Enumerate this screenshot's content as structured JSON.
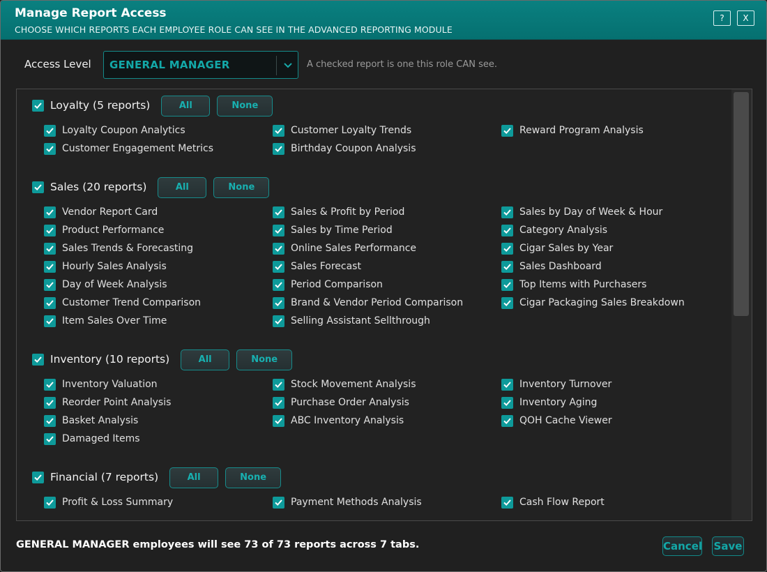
{
  "window": {
    "title": "Manage Report Access",
    "subtitle": "CHOOSE WHICH REPORTS EACH EMPLOYEE ROLE CAN SEE IN THE ADVANCED REPORTING MODULE",
    "help_label": "?",
    "close_label": "X"
  },
  "access": {
    "label": "Access Level",
    "selected": "GENERAL MANAGER",
    "hint": "A checked report is one this role CAN see."
  },
  "groups": [
    {
      "name": "Loyalty",
      "count": "(5 reports)",
      "checked": true,
      "all_label": "All",
      "none_label": "None",
      "items": [
        {
          "label": "Loyalty Coupon Analytics",
          "checked": true
        },
        {
          "label": "Customer Loyalty Trends",
          "checked": true
        },
        {
          "label": "Reward Program Analysis",
          "checked": true
        },
        {
          "label": "Customer Engagement Metrics",
          "checked": true
        },
        {
          "label": "Birthday Coupon Analysis",
          "checked": true
        }
      ]
    },
    {
      "name": "Sales",
      "count": "(20 reports)",
      "checked": true,
      "all_label": "All",
      "none_label": "None",
      "items": [
        {
          "label": "Vendor Report Card",
          "checked": true
        },
        {
          "label": "Sales & Profit by Period",
          "checked": true
        },
        {
          "label": "Sales by Day of Week & Hour",
          "checked": true
        },
        {
          "label": "Product Performance",
          "checked": true
        },
        {
          "label": "Sales by Time Period",
          "checked": true
        },
        {
          "label": "Category Analysis",
          "checked": true
        },
        {
          "label": "Sales Trends & Forecasting",
          "checked": true
        },
        {
          "label": "Online Sales Performance",
          "checked": true
        },
        {
          "label": "Cigar Sales by Year",
          "checked": true
        },
        {
          "label": "Hourly Sales Analysis",
          "checked": true
        },
        {
          "label": "Sales Forecast",
          "checked": true
        },
        {
          "label": "Sales Dashboard",
          "checked": true
        },
        {
          "label": "Day of Week Analysis",
          "checked": true
        },
        {
          "label": "Period Comparison",
          "checked": true
        },
        {
          "label": "Top Items with Purchasers",
          "checked": true
        },
        {
          "label": "Customer Trend Comparison",
          "checked": true
        },
        {
          "label": "Brand & Vendor Period Comparison",
          "checked": true
        },
        {
          "label": "Cigar Packaging Sales Breakdown",
          "checked": true
        },
        {
          "label": "Item Sales Over Time",
          "checked": true
        },
        {
          "label": "Selling Assistant Sellthrough",
          "checked": true
        }
      ]
    },
    {
      "name": "Inventory",
      "count": "(10 reports)",
      "checked": true,
      "all_label": "All",
      "none_label": "None",
      "items": [
        {
          "label": "Inventory Valuation",
          "checked": true
        },
        {
          "label": "Stock Movement Analysis",
          "checked": true
        },
        {
          "label": "Inventory Turnover",
          "checked": true
        },
        {
          "label": "Reorder Point Analysis",
          "checked": true
        },
        {
          "label": "Purchase Order Analysis",
          "checked": true
        },
        {
          "label": "Inventory Aging",
          "checked": true
        },
        {
          "label": "Basket Analysis",
          "checked": true
        },
        {
          "label": "ABC Inventory Analysis",
          "checked": true
        },
        {
          "label": "QOH Cache Viewer",
          "checked": true
        },
        {
          "label": "Damaged Items",
          "checked": true
        }
      ]
    },
    {
      "name": "Financial",
      "count": "(7 reports)",
      "checked": true,
      "all_label": "All",
      "none_label": "None",
      "items": [
        {
          "label": "Profit & Loss Summary",
          "checked": true
        },
        {
          "label": "Payment Methods Analysis",
          "checked": true
        },
        {
          "label": "Cash Flow Report",
          "checked": true
        }
      ]
    }
  ],
  "footer": {
    "summary": "GENERAL MANAGER employees will see 73 of 73 reports across 7 tabs.",
    "cancel_label": "Cancel",
    "save_label": "Save"
  },
  "colors": {
    "accent": "#0e9a9a",
    "titlebar": "#057070",
    "background": "#202020"
  }
}
